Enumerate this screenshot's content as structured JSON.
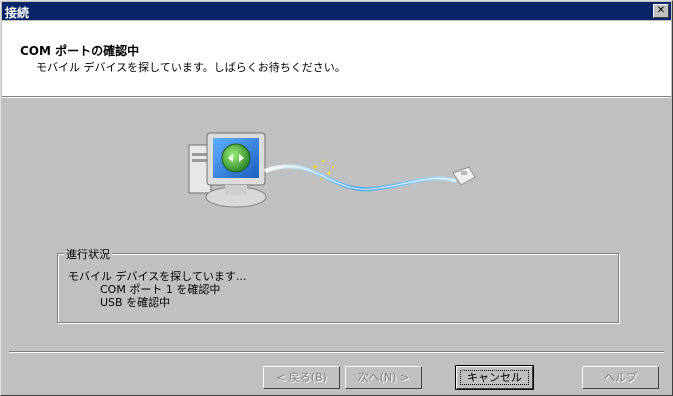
{
  "window": {
    "title": "接続",
    "close_glyph": "✕"
  },
  "header": {
    "title": "COM ポートの確認中",
    "subtitle": "モバイル デバイスを探しています。しばらくお待ちください。"
  },
  "progress": {
    "legend": "進行状況",
    "line1": "モバイル デバイスを探しています...",
    "line2": "COM ポート 1 を確認中",
    "line3": "USB を確認中"
  },
  "buttons": {
    "back": "< 戻る(B)",
    "next": "次へ(N) >",
    "cancel": "キャンセル",
    "help": "ヘルプ"
  },
  "icons": [
    "computer-icon",
    "mobile-device-icon",
    "close-icon"
  ],
  "colors": {
    "titlebar": "#0a246a",
    "face": "#c0c0c0",
    "cable": "#4aa8e8"
  }
}
